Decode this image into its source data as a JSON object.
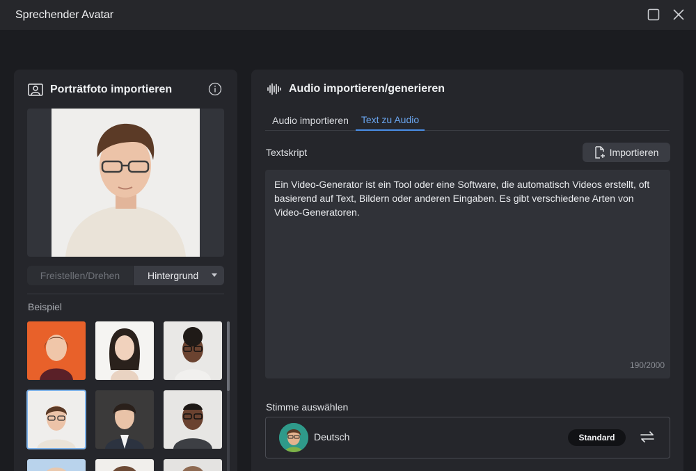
{
  "window": {
    "title": "Sprechender Avatar",
    "maximize_icon": "square-icon",
    "close_icon": "close-icon"
  },
  "left_panel": {
    "header_icon": "portrait-icon",
    "title": "Porträtfoto importieren",
    "info_icon": "info-icon",
    "buttons": {
      "crop_rotate": "Freistellen/Drehen",
      "background": "Hintergrund"
    },
    "examples_label": "Beispiel",
    "selected_example_index": 3
  },
  "right_panel": {
    "header_icon": "audio-wave-icon",
    "title": "Audio importieren/generieren",
    "tabs": [
      {
        "label": "Audio importieren",
        "active": false
      },
      {
        "label": "Text zu Audio",
        "active": true
      }
    ],
    "script_label": "Textskript",
    "import_button": "Importieren",
    "script_text": "Ein Video-Generator ist ein Tool oder eine Software, die automatisch Videos erstellt, oft basierend auf Text, Bildern oder anderen Eingaben. Es gibt verschiedene Arten von Video-Generatoren.",
    "char_counter": "190/2000",
    "voice_label": "Stimme auswählen",
    "voice": {
      "name": "Deutsch",
      "badge": "Standard",
      "swap_icon": "swap-arrows-icon"
    }
  },
  "colors": {
    "accent": "#4a8fe8",
    "background": "#1b1c20",
    "panel": "#25262b"
  }
}
